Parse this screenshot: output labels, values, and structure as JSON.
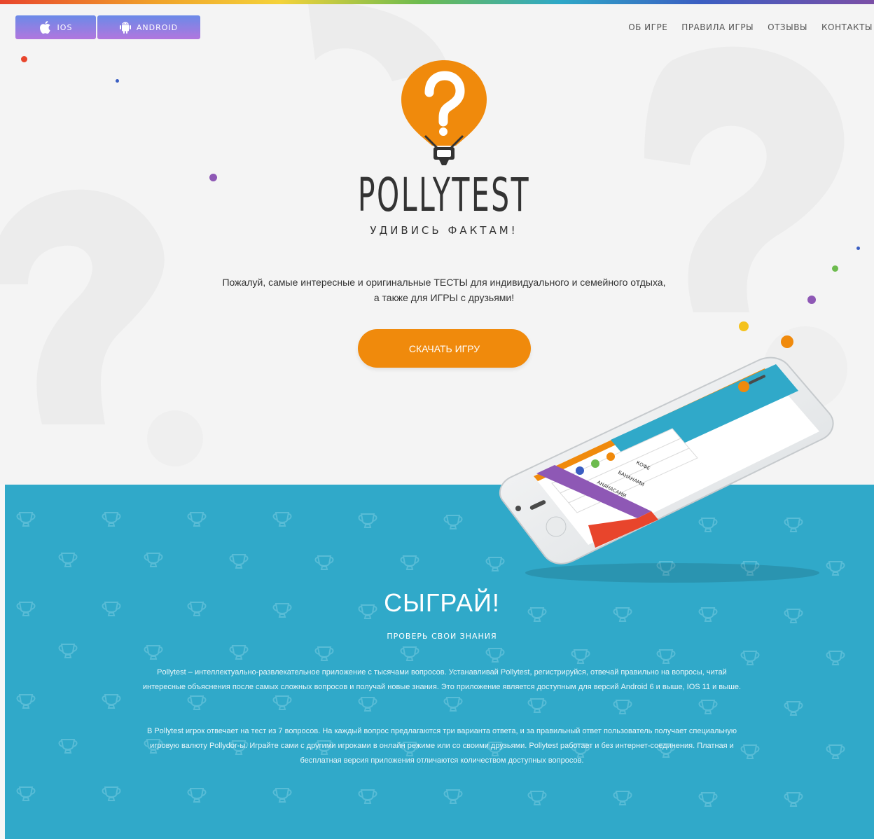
{
  "store_buttons": [
    {
      "label": "IOS",
      "icon": "apple-icon"
    },
    {
      "label": "ANDROID",
      "icon": "android-icon"
    }
  ],
  "nav": [
    "ОБ ИГРЕ",
    "ПРАВИЛА ИГРЫ",
    "ОТЗЫВЫ",
    "КОНТАКТЫ"
  ],
  "brand": {
    "name": "POLLYTEST",
    "tagline": "УДИВИСЬ ФАКТАМ!",
    "icon": "balloon-question-icon"
  },
  "intro": {
    "line1": "Пожалуй, самые интересные и оригинальные ТЕСТЫ для индивидуального и семейного отдыха,",
    "line2": "а также для ИГРЫ с друзьями!"
  },
  "cta_label": "СКАЧАТЬ ИГРУ",
  "phone_screen": {
    "answers": [
      "КОФЕ",
      "БАНАНАМИ",
      "АНАНАСАМИ"
    ]
  },
  "play": {
    "title": "СЫГРАЙ!",
    "subtitle": "ПРОВЕРЬ СВОИ ЗНАНИЯ",
    "para1": "Pollytest – интеллектуально-развлекательное приложение с тысячами вопросов. Устанавливай Pollytest, регистрируйся, отвечай правильно на вопросы, читай интересные объяснения после самых сложных вопросов и получай новые знания. Это приложение является доступным для версий Android 6 и выше, IOS 11 и выше.",
    "para2": "В Pollytest игрок отвечает на тест из 7 вопросов. На каждый вопрос предлагаются три варианта ответа, и за правильный ответ пользователь получает специальную игровую валюту Pollydor-ы. Играйте сами с другими игроками в онлайн режиме или со своими друзьями. Pollytest работает и без интернет-соединения. Платная и бесплатная версия приложения отличаются количеством доступных вопросов."
  },
  "colors": {
    "accent_orange": "#f08a0c",
    "section_blue": "#30a9c9",
    "button_gradient_top": "#6b8ae8",
    "button_gradient_bottom": "#b176de"
  }
}
